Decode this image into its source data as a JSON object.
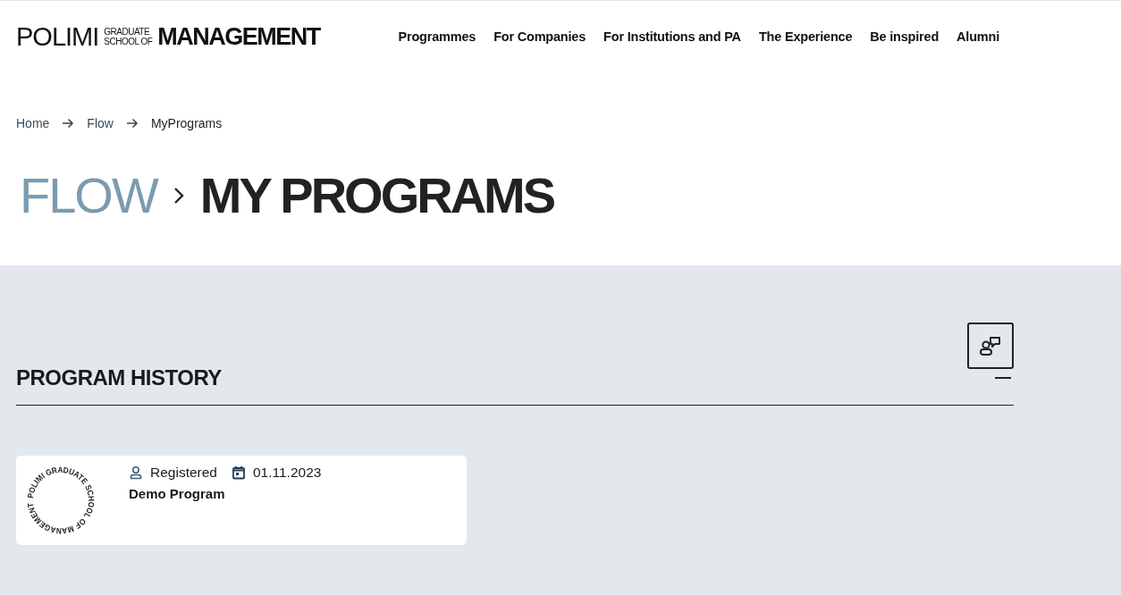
{
  "logo": {
    "word_1": "POLIMI",
    "word_2_lines": [
      "GRADUATE",
      "SCHOOL OF"
    ],
    "word_3": "MANAGEMENT"
  },
  "nav": [
    "Programmes",
    "For Companies",
    "For Institutions and PA",
    "The Experience",
    "Be inspired",
    "Alumni"
  ],
  "breadcrumb": [
    "Home",
    "Flow",
    "MyPrograms"
  ],
  "heading": {
    "parent": "FLOW",
    "current": "MY PROGRAMS"
  },
  "section": {
    "title": "PROGRAM HISTORY",
    "expanded": true,
    "programs": [
      {
        "badge_text": "POLIMI GRADUATE SCHOOL OF MANAGEMENT",
        "status": "Registered",
        "date": "01.11.2023",
        "name": "Demo Program"
      }
    ]
  }
}
